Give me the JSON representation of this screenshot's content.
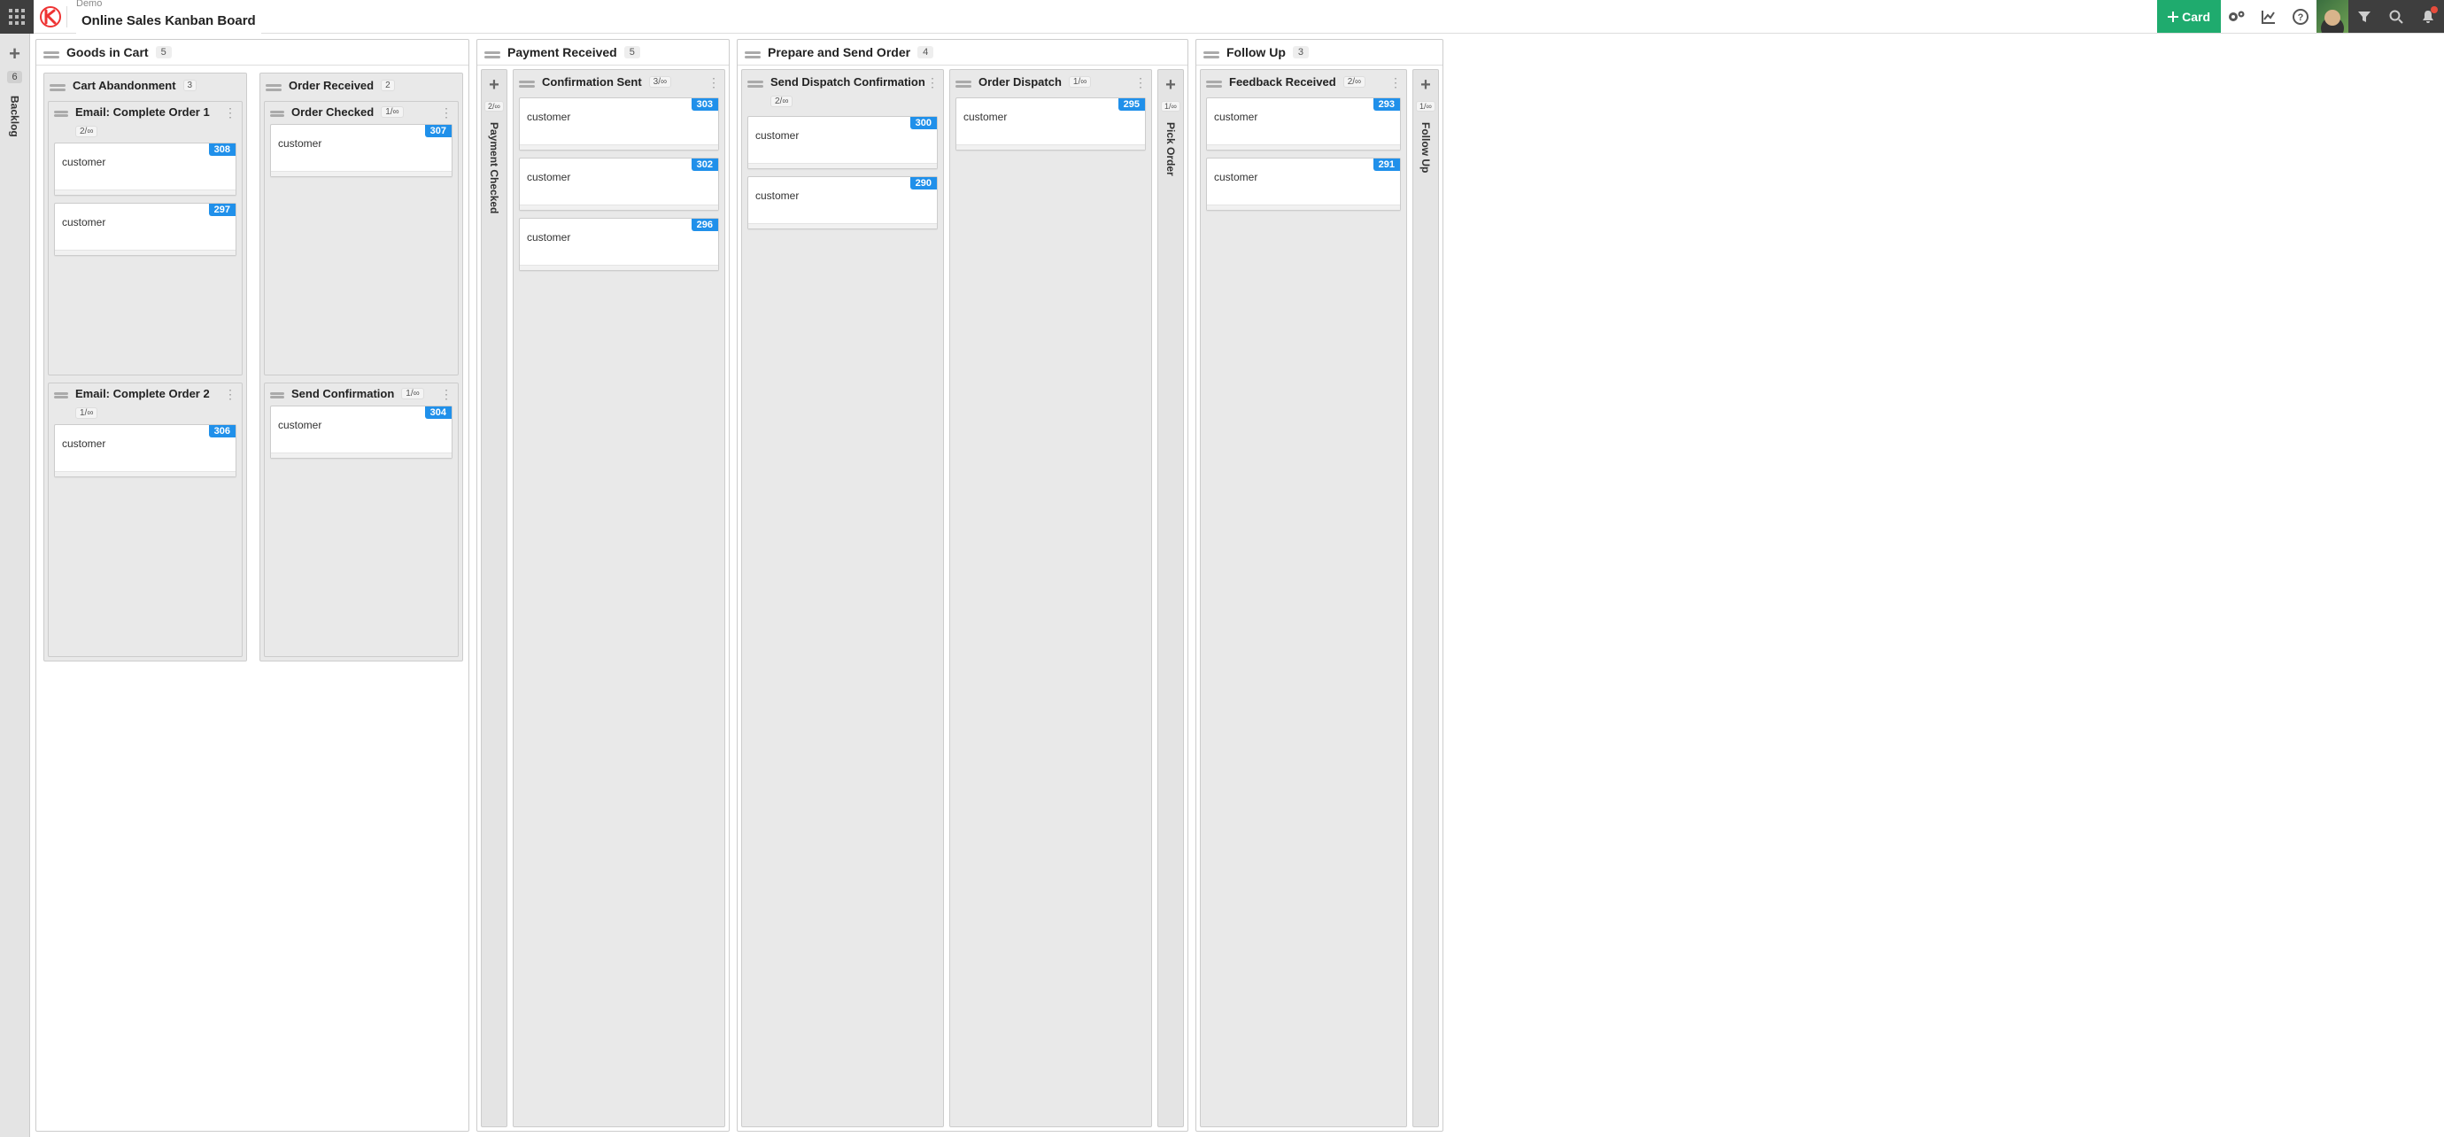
{
  "header": {
    "org": "Demo",
    "board": "Online Sales Kanban Board",
    "add_card_label": "Card"
  },
  "backlog": {
    "label": "Backlog",
    "count": "6"
  },
  "columns": [
    {
      "title": "Goods in Cart",
      "count": "5",
      "body_type": "two_stacks",
      "left_stack": [
        {
          "title": "Cart Abandonment",
          "count": "3",
          "subgroups": [
            {
              "title": "Email: Complete Order 1",
              "wip": "2/∞",
              "cards": [
                {
                  "num": "308",
                  "txt": "customer"
                },
                {
                  "num": "297",
                  "txt": "customer"
                }
              ]
            },
            {
              "title": "Email: Complete Order 2",
              "wip": "1/∞",
              "cards": [
                {
                  "num": "306",
                  "txt": "customer"
                }
              ]
            }
          ]
        }
      ],
      "right_stack": [
        {
          "title": "Order Received",
          "count": "2",
          "subgroups": [
            {
              "title": "Order Checked",
              "wip": "1/∞",
              "cards": [
                {
                  "num": "307",
                  "txt": "customer"
                }
              ]
            },
            {
              "title": "Send Confirmation",
              "wip": "1/∞",
              "cards": [
                {
                  "num": "304",
                  "txt": "customer"
                }
              ]
            }
          ]
        }
      ]
    },
    {
      "title": "Payment Received",
      "count": "5",
      "body_type": "rail_plus_lane",
      "rail": {
        "wip": "2/∞",
        "label": "Payment Checked"
      },
      "lane": {
        "title": "Confirmation Sent",
        "wip": "3/∞",
        "cards": [
          {
            "num": "303",
            "txt": "customer"
          },
          {
            "num": "302",
            "txt": "customer"
          },
          {
            "num": "296",
            "txt": "customer"
          }
        ]
      }
    },
    {
      "title": "Prepare and Send Order",
      "count": "4",
      "body_type": "two_lanes_plus_rail",
      "lanes": [
        {
          "title": "Send Dispatch Confirmation",
          "wip": "2/∞",
          "wrap": true,
          "cards": [
            {
              "num": "300",
              "txt": "customer"
            },
            {
              "num": "290",
              "txt": "customer"
            }
          ]
        },
        {
          "title": "Order Dispatch",
          "wip": "1/∞",
          "cards": [
            {
              "num": "295",
              "txt": "customer"
            }
          ]
        }
      ],
      "rail": {
        "wip": "1/∞",
        "label": "Pick Order"
      }
    },
    {
      "title": "Follow Up",
      "count": "3",
      "body_type": "lane_plus_rail",
      "lane": {
        "title": "Feedback Received",
        "wip": "2/∞",
        "cards": [
          {
            "num": "293",
            "txt": "customer"
          },
          {
            "num": "291",
            "txt": "customer"
          }
        ]
      },
      "rail": {
        "wip": "1/∞",
        "label": "Follow Up"
      }
    }
  ]
}
